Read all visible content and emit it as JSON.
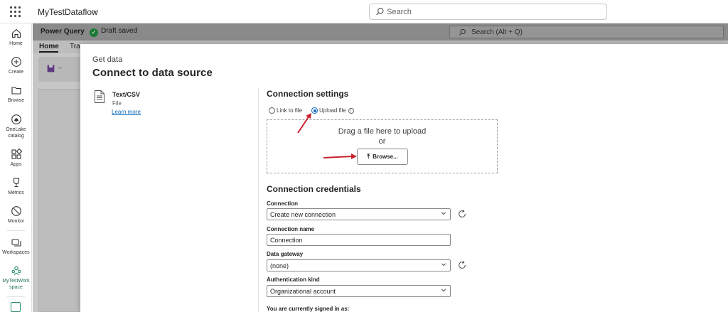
{
  "topbar": {
    "app_name": "MyTestDataflow",
    "search_placeholder": "Search"
  },
  "left_nav": {
    "items": [
      {
        "label": "Home",
        "icon": "home-icon"
      },
      {
        "label": "Create",
        "icon": "plus-circle-icon"
      },
      {
        "label": "Browse",
        "icon": "folder-icon"
      },
      {
        "label": "OneLake catalog",
        "icon": "onelake-icon"
      },
      {
        "label": "Apps",
        "icon": "apps-icon"
      },
      {
        "label": "Metrics",
        "icon": "trophy-icon"
      },
      {
        "label": "Monitor",
        "icon": "monitor-icon"
      },
      {
        "label": "Workspaces",
        "icon": "workspaces-icon"
      },
      {
        "label": "MyTestWork space",
        "icon": "workspace-people-icon"
      }
    ]
  },
  "power_query": {
    "title": "Power Query",
    "draft_status": "Draft saved",
    "search_placeholder": "Search (Alt + Q)",
    "tabs": [
      "Home",
      "Tra"
    ]
  },
  "dialog": {
    "eyebrow": "Get data",
    "title": "Connect to data source",
    "source": {
      "name": "Text/CSV",
      "type": "File",
      "learn_more": "Learn more"
    },
    "settings": {
      "heading": "Connection settings",
      "option_link": "Link to file",
      "option_upload": "Upload file",
      "selected_option": "upload",
      "drop_text": "Drag a file here to upload",
      "or_text": "or",
      "browse_label": "Browse..."
    },
    "credentials": {
      "heading": "Connection credentials",
      "connection_label": "Connection",
      "connection_value": "Create new connection",
      "name_label": "Connection name",
      "name_value": "Connection",
      "gateway_label": "Data gateway",
      "gateway_value": "(none)",
      "auth_label": "Authentication kind",
      "auth_value": "Organizational account",
      "signed_in_label": "You are currently signed in as:"
    }
  },
  "colors": {
    "accent": "#0f6cbd",
    "annotation_arrow": "#c8232c",
    "success": "#1b7a35"
  }
}
